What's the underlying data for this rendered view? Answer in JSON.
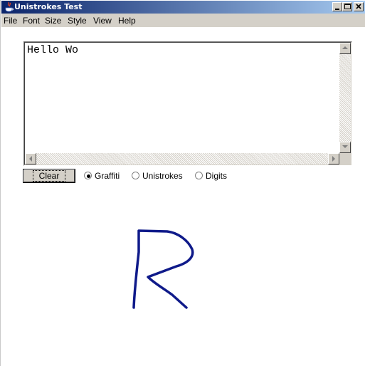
{
  "window": {
    "title": "Unistrokes Test",
    "icon": "java-cup-icon",
    "controls": [
      "minimize-icon",
      "maximize-icon",
      "close-icon"
    ]
  },
  "menu": {
    "items": [
      {
        "label": "File"
      },
      {
        "label": "Font"
      },
      {
        "label": "Size"
      },
      {
        "label": "Style"
      },
      {
        "label": "View"
      },
      {
        "label": "Help"
      }
    ]
  },
  "text_area": {
    "value": "Hello Wo"
  },
  "controls": {
    "clear_label": "Clear",
    "modes": [
      {
        "label": "Graffiti",
        "selected": true
      },
      {
        "label": "Unistrokes",
        "selected": false
      },
      {
        "label": "Digits",
        "selected": false
      }
    ]
  },
  "canvas": {
    "stroke_color": "#0f1a8a",
    "recognized_glyph": "R"
  }
}
